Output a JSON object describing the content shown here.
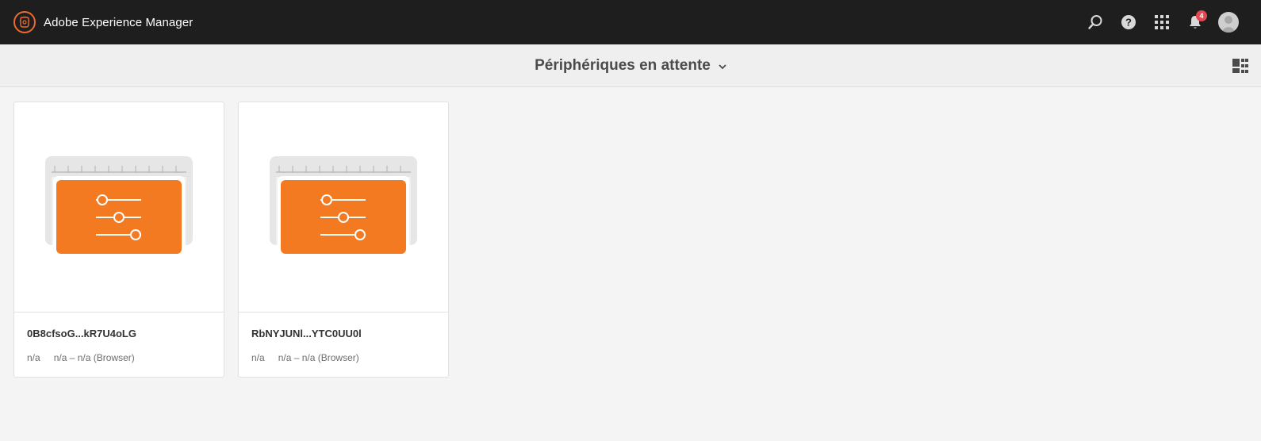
{
  "app": {
    "title": "Adobe Experience Manager",
    "icons": [
      "adobe-experience-manager-logo",
      "search-icon",
      "help-icon",
      "apps-grid-icon",
      "bell-icon",
      "avatar"
    ],
    "notification_count": "4",
    "colors": {
      "topbar": "#1e1e1e",
      "brand": "#eb6b2f",
      "accent": "#f47a22",
      "badge": "#e34850"
    }
  },
  "actionbar": {
    "title": "Périphériques en attente",
    "icons": [
      "chevron-down-icon",
      "card-view-icon"
    ]
  },
  "cards": [
    {
      "title": "0B8cfsoG...kR7U4oLG",
      "meta1": "n/a",
      "meta2": "n/a – n/a (Browser)",
      "icon": "device-settings-thumbnail"
    },
    {
      "title": "RbNYJUNl...YTC0UU0l",
      "meta1": "n/a",
      "meta2": "n/a – n/a (Browser)",
      "icon": "device-settings-thumbnail"
    }
  ]
}
